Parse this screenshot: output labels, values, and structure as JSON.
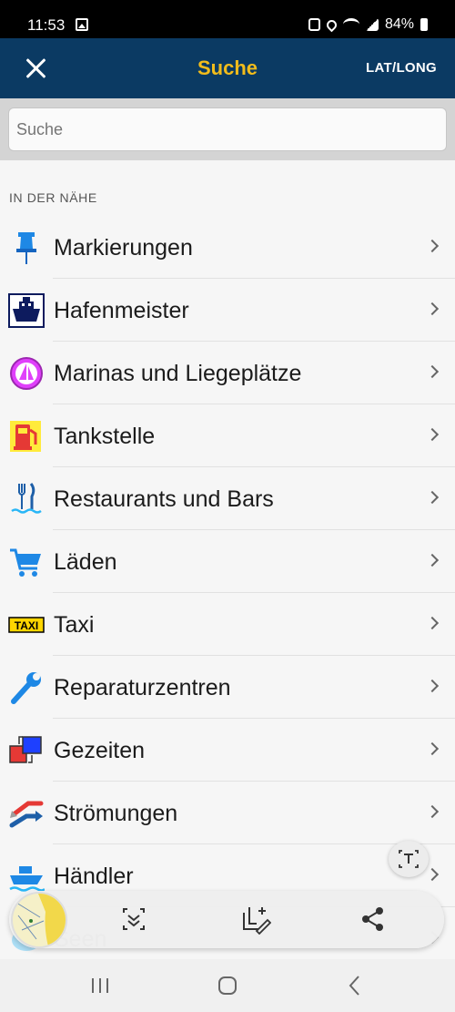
{
  "status_bar": {
    "time": "11:53",
    "battery": "84%"
  },
  "app_bar": {
    "title": "Suche",
    "right_action": "LAT/LONG"
  },
  "search": {
    "placeholder": "Suche"
  },
  "section": {
    "title": "IN DER NÄHE"
  },
  "items": [
    {
      "label": "Markierungen",
      "icon": "pin-icon"
    },
    {
      "label": "Hafenmeister",
      "icon": "harbor-master-icon"
    },
    {
      "label": "Marinas und Liegeplätze",
      "icon": "marina-icon"
    },
    {
      "label": "Tankstelle",
      "icon": "fuel-icon"
    },
    {
      "label": "Restaurants und Bars",
      "icon": "restaurant-icon"
    },
    {
      "label": "Läden",
      "icon": "shopping-cart-icon"
    },
    {
      "label": "Taxi",
      "icon": "taxi-icon"
    },
    {
      "label": "Reparaturzentren",
      "icon": "wrench-icon"
    },
    {
      "label": "Gezeiten",
      "icon": "tide-icon"
    },
    {
      "label": "Strömungen",
      "icon": "current-icon"
    },
    {
      "label": "Händler",
      "icon": "boat-dealer-icon"
    },
    {
      "label": "Seen",
      "icon": "lake-icon"
    }
  ],
  "colors": {
    "header_bg": "#0b3a63",
    "title": "#f2bc1b"
  },
  "taxi_icon_text": "TAXI"
}
